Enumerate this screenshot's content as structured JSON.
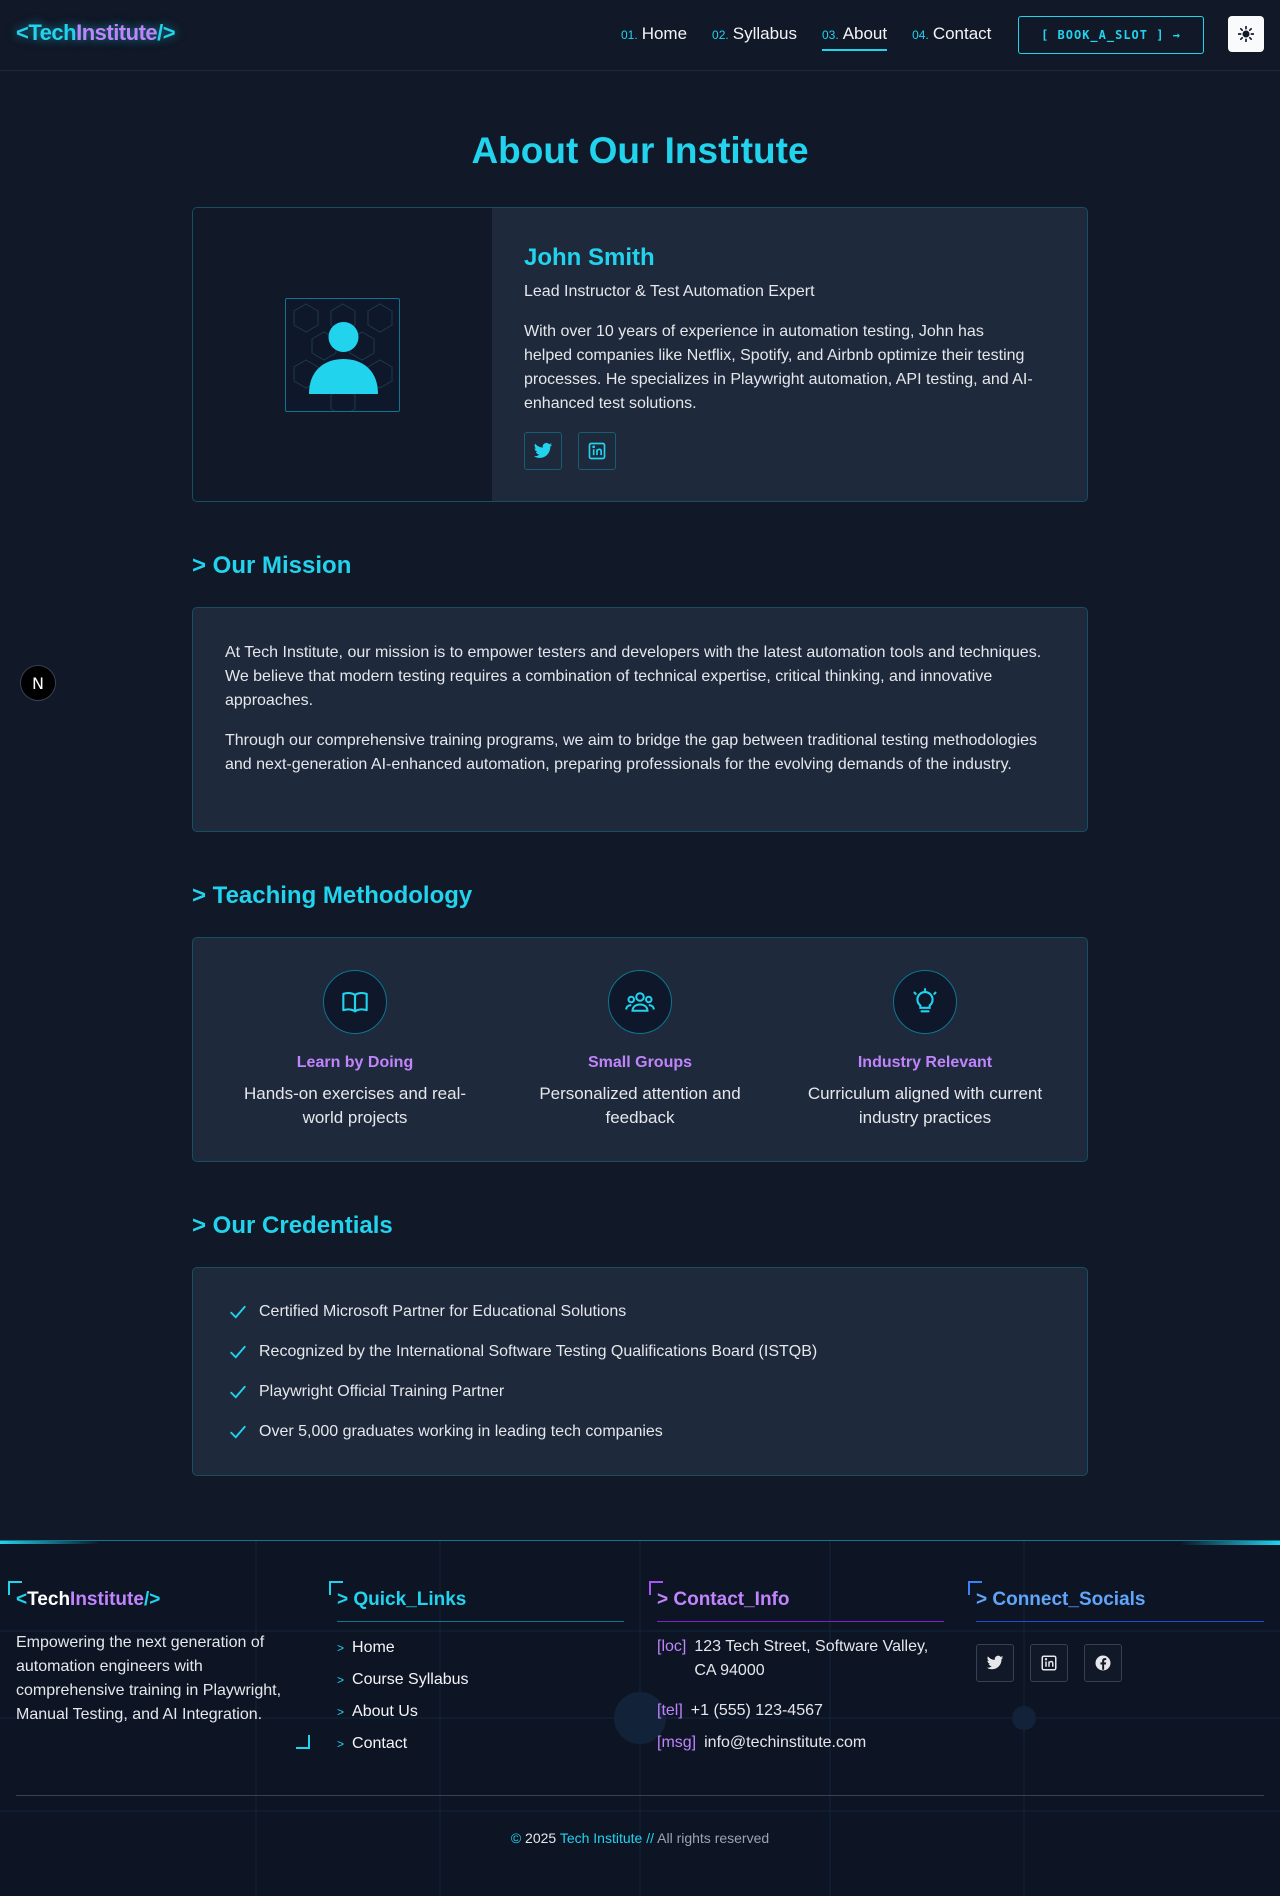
{
  "header": {
    "logo": {
      "lt": "<",
      "part1": "Tech",
      "part2": "Institute",
      "slash": "/>"
    },
    "nav": [
      {
        "num": "01.",
        "label": "Home"
      },
      {
        "num": "02.",
        "label": "Syllabus"
      },
      {
        "num": "03.",
        "label": "About",
        "active": true
      },
      {
        "num": "04.",
        "label": "Contact"
      }
    ],
    "book_button": "[ BOOK_A_SLOT ] →",
    "theme_icon": "sun-icon"
  },
  "page_title": "About Our Institute",
  "profile": {
    "name": "John Smith",
    "role": "Lead Instructor & Test Automation Expert",
    "bio": "With over 10 years of experience in automation testing, John has helped companies like Netflix, Spotify, and Airbnb optimize their testing processes. He specializes in Playwright automation, API testing, and AI-enhanced test solutions.",
    "socials": [
      "twitter-icon",
      "linkedin-icon"
    ]
  },
  "mission": {
    "heading": "> Our Mission",
    "paragraphs": [
      "At Tech Institute, our mission is to empower testers and developers with the latest automation tools and techniques. We believe that modern testing requires a combination of technical expertise, critical thinking, and innovative approaches.",
      "Through our comprehensive training programs, we aim to bridge the gap between traditional testing methodologies and next-generation AI-enhanced automation, preparing professionals for the evolving demands of the industry."
    ]
  },
  "methodology": {
    "heading": "> Teaching Methodology",
    "items": [
      {
        "icon": "book-icon",
        "title": "Learn by Doing",
        "desc": "Hands-on exercises and real-world projects"
      },
      {
        "icon": "users-icon",
        "title": "Small Groups",
        "desc": "Personalized attention and feedback"
      },
      {
        "icon": "lightbulb-icon",
        "title": "Industry Relevant",
        "desc": "Curriculum aligned with current industry practices"
      }
    ]
  },
  "credentials": {
    "heading": "> Our Credentials",
    "items": [
      "Certified Microsoft Partner for Educational Solutions",
      "Recognized by the International Software Testing Qualifications Board (ISTQB)",
      "Playwright Official Training Partner",
      "Over 5,000 graduates working in leading tech companies"
    ]
  },
  "floating_badge": "N",
  "footer": {
    "tagline": "Empowering the next generation of automation engineers with comprehensive training in Playwright, Manual Testing, and AI Integration.",
    "quick_links_heading": "> Quick_Links",
    "quick_links": [
      "Home",
      "Course Syllabus",
      "About Us",
      "Contact"
    ],
    "contact_heading": "> Contact_Info",
    "contact": [
      {
        "key": "[loc]",
        "value": "123 Tech Street, Software Valley, CA 94000"
      },
      {
        "key": "[tel]",
        "value": "+1 (555) 123-4567"
      },
      {
        "key": "[msg]",
        "value": "info@techinstitute.com"
      }
    ],
    "socials_heading": "> Connect_Socials",
    "socials": [
      "twitter-icon",
      "linkedin-icon",
      "facebook-icon"
    ],
    "copyright": {
      "symbol": "©",
      "year": "2025",
      "name": "Tech Institute",
      "sep": "//",
      "rights": "All rights reserved"
    }
  },
  "colors": {
    "accent": "#22d3ee",
    "accent2": "#c084fc",
    "bg": "#111827",
    "card": "#1e293b"
  }
}
